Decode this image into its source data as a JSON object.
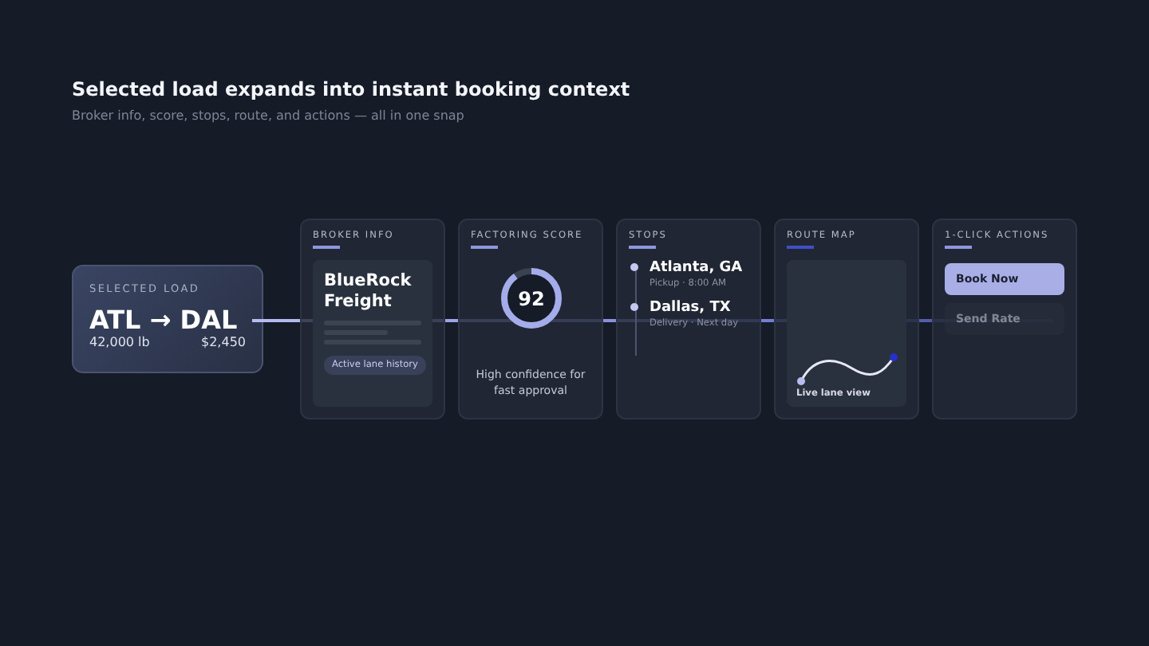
{
  "header": {
    "title": "Selected load expands into instant booking context",
    "subtitle": "Broker info, score, stops, route, and actions — all in one snap"
  },
  "selected_load": {
    "label": "SELECTED LOAD",
    "route": "ATL → DAL",
    "weight": "42,000 lb",
    "price": "$2,450"
  },
  "broker": {
    "title": "BROKER INFO",
    "name": "BlueRock Freight",
    "tag": "Active lane history"
  },
  "score": {
    "title": "FACTORING SCORE",
    "value": "92",
    "note": "High confidence for fast approval"
  },
  "stops": {
    "title": "STOPS",
    "items": [
      {
        "city": "Atlanta, GA",
        "detail": "Pickup · 8:00 AM"
      },
      {
        "city": "Dallas, TX",
        "detail": "Delivery · Next day"
      }
    ]
  },
  "route_map": {
    "title": "ROUTE MAP",
    "caption": "Live lane view"
  },
  "actions": {
    "title": "1-CLICK ACTIONS",
    "buttons": [
      {
        "label": "Book Now",
        "kind": "primary",
        "disabled": false
      },
      {
        "label": "Send Rate",
        "kind": "secondary",
        "disabled": true
      }
    ]
  }
}
